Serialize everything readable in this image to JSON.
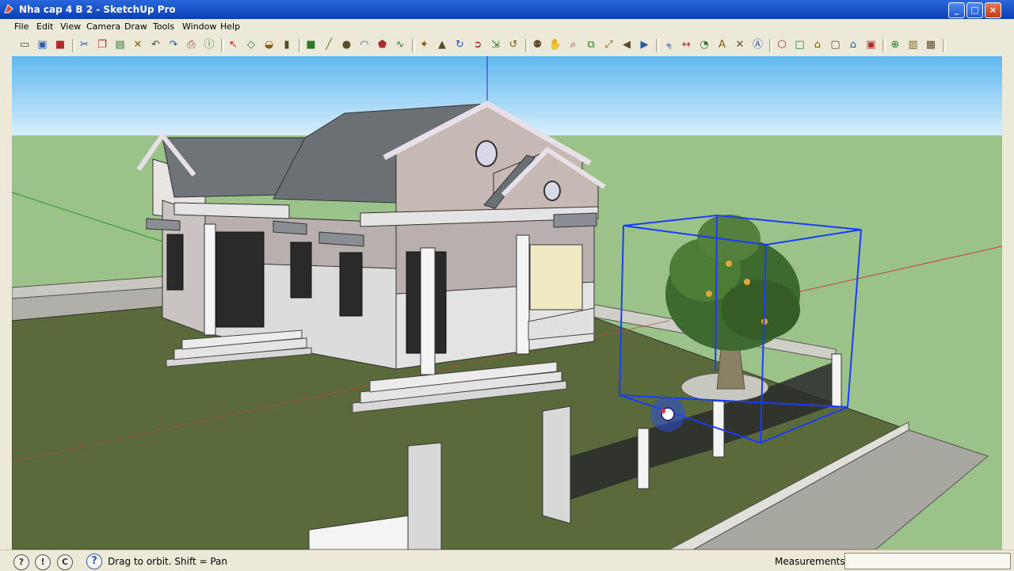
{
  "window": {
    "title": "Nha cap 4 B 2 - SketchUp Pro",
    "min": "_",
    "max": "□",
    "close": "×"
  },
  "menu": [
    "File",
    "Edit",
    "View",
    "Camera",
    "Draw",
    "Tools",
    "Window",
    "Help"
  ],
  "toolbar": {
    "groups": [
      [
        "new-icon",
        "open-icon",
        "save-icon"
      ],
      [
        "cut-icon",
        "copy-icon",
        "paste-icon",
        "erase-icon",
        "undo-icon",
        "redo-icon",
        "print-icon",
        "model-info-icon"
      ],
      [
        "select-icon",
        "make-component-icon",
        "paint-bucket-icon",
        "eraser-icon"
      ],
      [
        "rectangle-icon",
        "line-icon",
        "circle-icon",
        "arc-icon",
        "polygon-icon",
        "freehand-icon"
      ],
      [
        "move-icon",
        "push-pull-icon",
        "rotate-icon",
        "follow-me-icon",
        "scale-icon",
        "offset-icon"
      ],
      [
        "orbit-icon",
        "pan-icon",
        "zoom-icon",
        "zoom-window-icon",
        "zoom-extents-icon",
        "previous-view-icon",
        "next-view-icon"
      ],
      [
        "tape-measure-icon",
        "dimension-icon",
        "protractor-icon",
        "text-icon",
        "axes-icon",
        "3d-text-icon"
      ],
      [
        "iso-view-icon",
        "top-view-icon",
        "front-view-icon",
        "right-view-icon",
        "back-view-icon",
        "left-view-icon"
      ],
      [
        "section-plane-icon",
        "display-section-icon",
        "section-cuts-icon"
      ]
    ]
  },
  "status": {
    "icons": [
      "geolocation-icon",
      "credits-icon",
      "user-icon"
    ],
    "help": "?",
    "hint": "Drag to orbit.  Shift = Pan",
    "measurements_label": "Measurements",
    "measurements_value": ""
  },
  "colors": {
    "title_bar": "#0a3fb3",
    "chrome": "#ece9d8",
    "sky": "#7fc6ef",
    "ground": "#9bc288",
    "selection": "#1a3cff"
  }
}
